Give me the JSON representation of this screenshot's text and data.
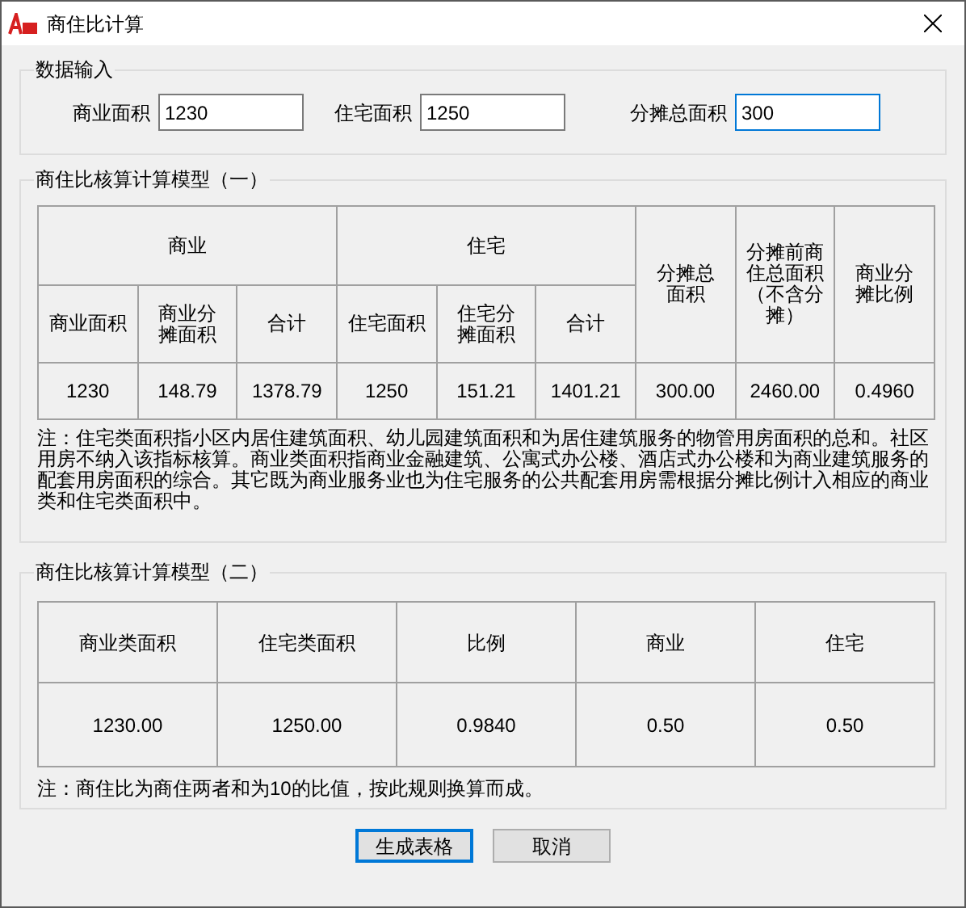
{
  "window": {
    "title": "商住比计算"
  },
  "input_group": {
    "title": "数据输入",
    "fields": [
      {
        "label": "商业面积",
        "value": "1230",
        "focused": false
      },
      {
        "label": "住宅面积",
        "value": "1250",
        "focused": false
      },
      {
        "label": "分摊总面积",
        "value": "300",
        "focused": true
      }
    ]
  },
  "model_1": {
    "title": "商住比核算计算模型（一）",
    "headers": [
      {
        "kind": "group",
        "label": "商业",
        "columns": [
          "商业面积",
          "商业分摊面积",
          "合计"
        ]
      },
      {
        "kind": "group",
        "label": "住宅",
        "columns": [
          "住宅面积",
          "住宅分摊面积",
          "合计"
        ]
      },
      {
        "kind": "single",
        "label": "分摊总面积"
      },
      {
        "kind": "single",
        "label": "分摊前商住总面积（不含分摊）"
      },
      {
        "kind": "single",
        "label": "商业分摊比例"
      }
    ],
    "row": [
      "1230",
      "148.79",
      "1378.79",
      "1250",
      "151.21",
      "1401.21",
      "300.00",
      "2460.00",
      "0.4960"
    ],
    "note": "注：住宅类面积指小区内居住建筑面积、幼儿园建筑面积和为居住建筑服务的物管用房面积的总和。社区用房不纳入该指标核算。商业类面积指商业金融建筑、公寓式办公楼、酒店式办公楼和为商业建筑服务的配套用房面积的综合。其它既为商业服务业也为住宅服务的公共配套用房需根据分摊比例计入相应的商业类和住宅类面积中。"
  },
  "model_2": {
    "title": "商住比核算计算模型（二）",
    "columns": [
      "商业类面积",
      "住宅类面积",
      "比例",
      "商业",
      "住宅"
    ],
    "row": [
      "1230.00",
      "1250.00",
      "0.9840",
      "0.50",
      "0.50"
    ],
    "note": "注：商住比为商住两者和为10的比值，按此规则换算而成。"
  },
  "buttons": [
    {
      "label": "生成表格",
      "focused": true
    },
    {
      "label": "取消",
      "focused": false
    }
  ]
}
